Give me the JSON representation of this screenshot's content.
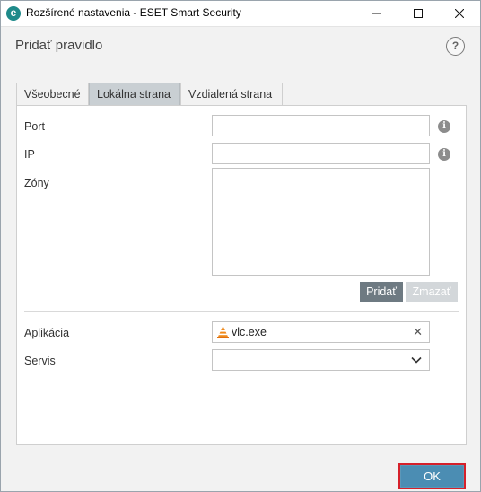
{
  "window": {
    "title": "Rozšírené nastavenia - ESET Smart Security",
    "app_icon_letter": "e"
  },
  "header": {
    "title": "Pridať pravidlo",
    "help_label": "?"
  },
  "tabs": [
    {
      "label": "Všeobecné",
      "active": false
    },
    {
      "label": "Lokálna strana",
      "active": true
    },
    {
      "label": "Vzdialená strana",
      "active": false
    }
  ],
  "form": {
    "port_label": "Port",
    "port_value": "",
    "ip_label": "IP",
    "ip_value": "",
    "zones_label": "Zóny",
    "add_button": "Pridať",
    "remove_button": "Zmazať",
    "application_label": "Aplikácia",
    "application_value": "vlc.exe",
    "service_label": "Servis",
    "service_value": ""
  },
  "footer": {
    "ok_label": "OK"
  },
  "colors": {
    "ok_highlight": "#d6202a",
    "ok_button": "#4b8db3",
    "accent": "#1e8a8a"
  }
}
